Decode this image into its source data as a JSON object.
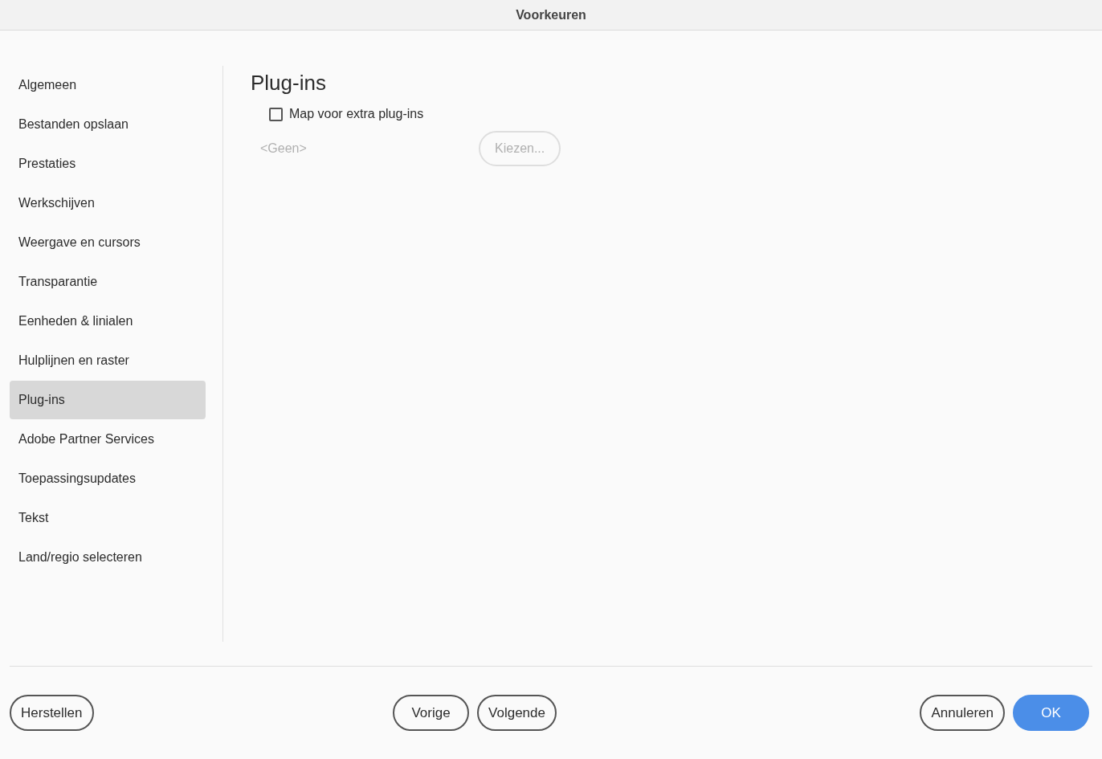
{
  "window": {
    "title": "Voorkeuren"
  },
  "sidebar": {
    "items": [
      {
        "label": "Algemeen",
        "selected": false
      },
      {
        "label": "Bestanden opslaan",
        "selected": false
      },
      {
        "label": "Prestaties",
        "selected": false
      },
      {
        "label": "Werkschijven",
        "selected": false
      },
      {
        "label": "Weergave en cursors",
        "selected": false
      },
      {
        "label": "Transparantie",
        "selected": false
      },
      {
        "label": "Eenheden & linialen",
        "selected": false
      },
      {
        "label": "Hulplijnen en raster",
        "selected": false
      },
      {
        "label": "Plug-ins",
        "selected": true
      },
      {
        "label": "Adobe Partner Services",
        "selected": false
      },
      {
        "label": "Toepassingsupdates",
        "selected": false
      },
      {
        "label": "Tekst",
        "selected": false
      },
      {
        "label": "Land/regio selecteren",
        "selected": false
      }
    ]
  },
  "content": {
    "heading": "Plug-ins",
    "checkbox": {
      "label": "Map voor extra plug-ins",
      "checked": false
    },
    "folder_path": {
      "text": "<Geen>",
      "disabled": true
    },
    "choose_button": {
      "label": "Kiezen...",
      "disabled": true
    }
  },
  "footer": {
    "left_buttons": [
      {
        "label": "Herstellen",
        "kind": "secondary"
      }
    ],
    "center_buttons": [
      {
        "label": "Vorige",
        "kind": "secondary"
      },
      {
        "label": "Volgende",
        "kind": "secondary"
      }
    ],
    "right_buttons": [
      {
        "label": "Annuleren",
        "kind": "secondary"
      },
      {
        "label": "OK",
        "kind": "primary"
      }
    ]
  }
}
